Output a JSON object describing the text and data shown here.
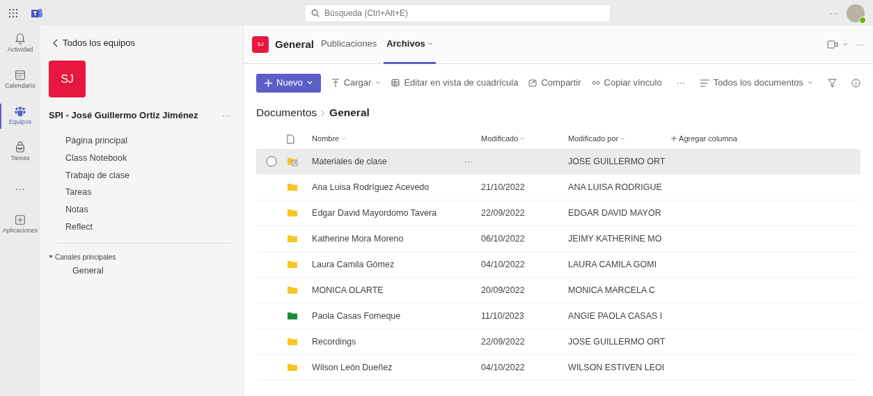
{
  "top_bar": {
    "search": {
      "placeholder": "Búsqueda (Ctrl+Alt+E)"
    },
    "more": "···"
  },
  "rail": [
    {
      "label": "Actividad",
      "selected": false
    },
    {
      "label": "Calendario",
      "selected": false
    },
    {
      "label": "Equipos",
      "selected": true
    },
    {
      "label": "Tareas",
      "selected": false
    },
    {
      "label": "···",
      "selected": false
    },
    {
      "label": "Aplicaciones",
      "selected": false
    }
  ],
  "team_panel": {
    "back": "Todos los equipos",
    "avatar": "SJ",
    "name": "SPI - José Guillermo Ortiz Jiménez",
    "more": "···",
    "items": [
      {
        "label": "Página principal"
      },
      {
        "label": "Class Notebook"
      },
      {
        "label": "Trabajo de clase"
      },
      {
        "label": "Tareas"
      },
      {
        "label": "Notas"
      },
      {
        "label": "Reflect"
      }
    ],
    "section": {
      "label": "Canales principales",
      "expanded": true,
      "channels": [
        {
          "label": "General"
        }
      ]
    }
  },
  "channel_header": {
    "avatar": "SJ",
    "title": "General",
    "more": "···",
    "tabs": [
      {
        "label": "Publicaciones",
        "selected": false
      },
      {
        "label": "Archivos",
        "selected": true
      }
    ]
  },
  "toolbar": {
    "new": "Nuevo",
    "items": [
      {
        "label": "Cargar",
        "dropdown": true
      },
      {
        "label": "Editar en vista de cuadrícula",
        "dropdown": false
      },
      {
        "label": "Compartir",
        "dropdown": false
      },
      {
        "label": "Copiar vínculo",
        "dropdown": false
      }
    ],
    "more": "···",
    "view": "Todos los documentos"
  },
  "breadcrumb": [
    "Documentos",
    "General"
  ],
  "table": {
    "columns": [
      "Nombre",
      "Modificado",
      "Modificado por"
    ],
    "add_column": "Agregar columna",
    "rows": [
      {
        "kind": "shared",
        "name": "Materiales de clase",
        "modified": "",
        "modified_by": "JOSE GUILLERMO ORT",
        "more": "···",
        "selected": true,
        "color": "#f2c230"
      },
      {
        "kind": "folder",
        "name": "Ana Luisa Rodríguez Acevedo",
        "modified": "21/10/2022",
        "modified_by": "ANA LUISA RODRIGUE",
        "selected": false,
        "color": "#f8c521"
      },
      {
        "kind": "folder",
        "name": "Edgar David Mayordomo Tavera",
        "modified": "22/09/2022",
        "modified_by": "EDGAR DAVID MAYOR",
        "selected": false,
        "color": "#f8c521"
      },
      {
        "kind": "folder",
        "name": "Katherine Mora Moreno",
        "modified": "06/10/2022",
        "modified_by": "JEIMY KATHERINE MO",
        "selected": false,
        "color": "#f8c521"
      },
      {
        "kind": "folder",
        "name": "Laura Camila Gómez",
        "modified": "04/10/2022",
        "modified_by": "LAURA CAMILA GOMI",
        "selected": false,
        "color": "#f8c521"
      },
      {
        "kind": "folder",
        "name": "MONICA OLARTE",
        "modified": "20/09/2022",
        "modified_by": "MONICA MARCELA C",
        "selected": false,
        "color": "#f8c521"
      },
      {
        "kind": "folder",
        "name": "Paola Casas Fomeque",
        "modified": "11/10/2023",
        "modified_by": "ANGIE PAOLA CASAS I",
        "selected": false,
        "color": "#1a8a3a"
      },
      {
        "kind": "folder",
        "name": "Recordings",
        "modified": "22/09/2022",
        "modified_by": "JOSE GUILLERMO ORT",
        "selected": false,
        "color": "#f8c521"
      },
      {
        "kind": "folder",
        "name": "Wilson León Dueñez",
        "modified": "04/10/2022",
        "modified_by": "WILSON ESTIVEN LEOI",
        "selected": false,
        "color": "#f8c521"
      }
    ]
  }
}
